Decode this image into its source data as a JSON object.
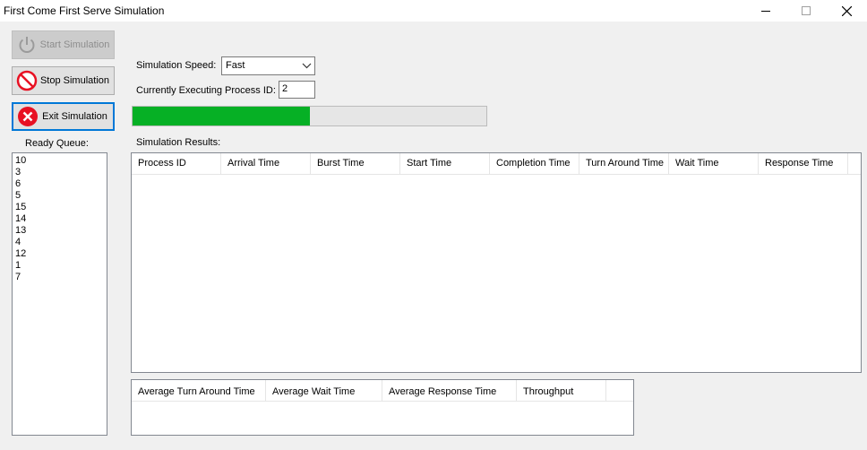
{
  "window": {
    "title": "First Come First Serve Simulation"
  },
  "buttons": {
    "start": {
      "label": "Start Simulation",
      "icon": "power-icon",
      "enabled": false
    },
    "stop": {
      "label": "Stop Simulation",
      "icon": "prohibited-icon"
    },
    "exit": {
      "label": "Exit Simulation",
      "icon": "close-circle-icon",
      "accent": "#e81123"
    }
  },
  "ready_queue": {
    "label": "Ready Queue:",
    "items": [
      "10",
      "3",
      "6",
      "5",
      "15",
      "14",
      "13",
      "4",
      "12",
      "1",
      "7"
    ]
  },
  "controls": {
    "speed_label": "Simulation Speed:",
    "speed_value": "Fast",
    "pid_label": "Currently Executing Process ID:",
    "pid_value": "2"
  },
  "progress": {
    "fraction": 0.5,
    "color": "#06b025"
  },
  "results": {
    "label": "Simulation Results:",
    "columns": [
      "Process ID",
      "Arrival Time",
      "Burst Time",
      "Start Time",
      "Completion Time",
      "Turn Around Time",
      "Wait Time",
      "Response Time"
    ]
  },
  "averages": {
    "columns": [
      "Average Turn Around Time",
      "Average Wait Time",
      "Average Response Time",
      "Throughput"
    ]
  }
}
